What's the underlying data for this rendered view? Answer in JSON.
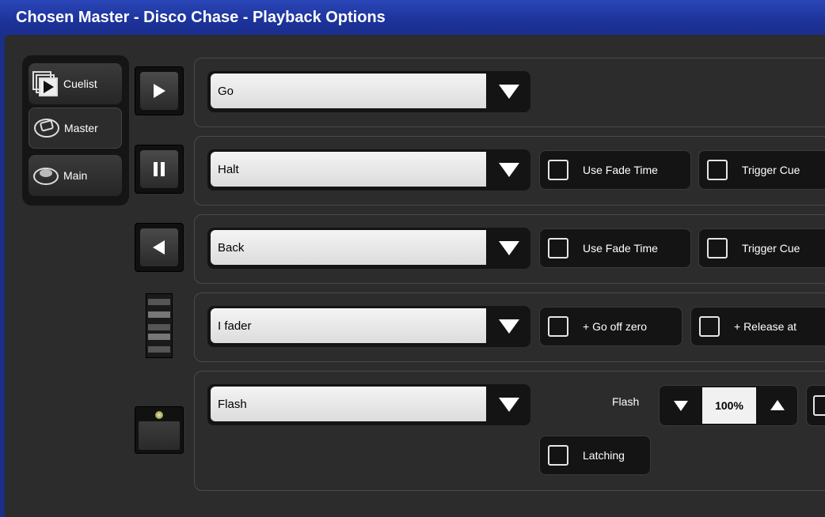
{
  "window": {
    "title": "Chosen Master - Disco Chase - Playback Options"
  },
  "tabs": [
    {
      "label": "Cuelist",
      "icon": "cuelist-icon"
    },
    {
      "label": "Master",
      "icon": "master-icon"
    },
    {
      "label": "Main",
      "icon": "main-icon"
    }
  ],
  "rows": {
    "go": {
      "value": "Go",
      "icon": "play-icon"
    },
    "halt": {
      "value": "Halt",
      "icon": "pause-icon",
      "opt1": "Use Fade Time",
      "opt2": "Trigger Cue"
    },
    "back": {
      "value": "Back",
      "icon": "back-icon",
      "opt1": "Use Fade Time",
      "opt2": "Trigger Cue"
    },
    "fader": {
      "value": "I fader",
      "icon": "fader-icon",
      "opt1": "+ Go off zero",
      "opt2": "+ Release at"
    },
    "flash": {
      "value": "Flash",
      "icon": "flash-button-icon",
      "flash_label": "Flash",
      "flash_level": "100%",
      "latching": "Latching"
    }
  },
  "colors": {
    "titlebar": "#1d339a",
    "panel": "#2c2c2c",
    "field": "#e8e8e8"
  }
}
